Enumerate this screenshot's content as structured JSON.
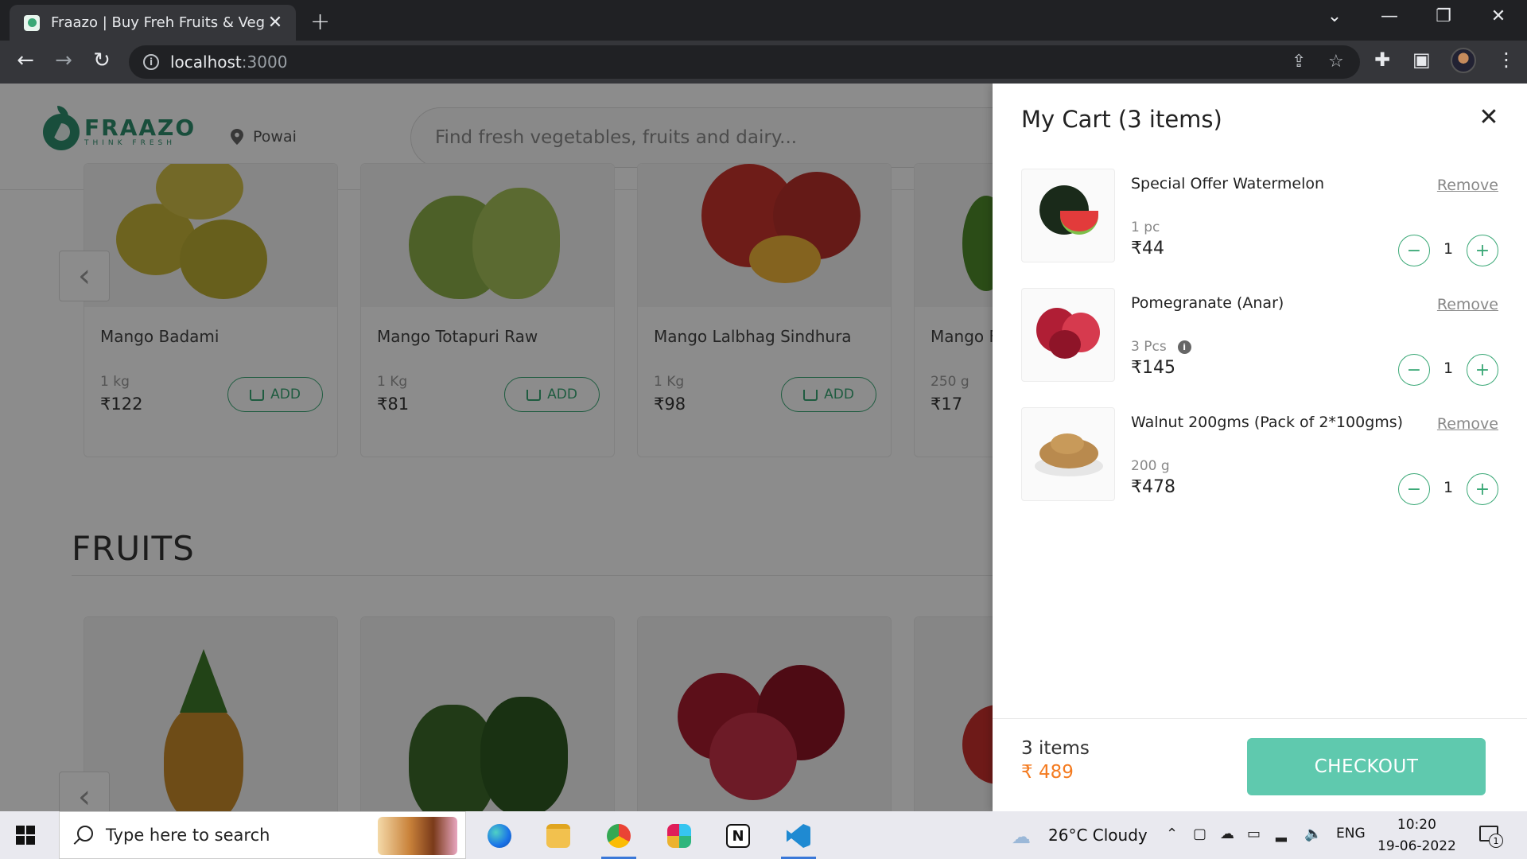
{
  "browser": {
    "tab_title": "Fraazo | Buy Freh Fruits & Vegitab",
    "url_host": "localhost",
    "url_port": ":3000"
  },
  "site": {
    "logo_name": "FRAAZO",
    "logo_tagline": "THINK FRESH",
    "location": "Powai",
    "search_placeholder": "Find fresh vegetables, fruits and dairy...",
    "add_label": "ADD",
    "products": [
      {
        "name": "Mango Badami",
        "qty": "1 kg",
        "price": "₹122"
      },
      {
        "name": "Mango Totapuri Raw",
        "qty": "1 Kg",
        "price": "₹81"
      },
      {
        "name": "Mango Lalbhag Sindhura",
        "qty": "1 Kg",
        "price": "₹98"
      },
      {
        "name": "Mango F",
        "qty": "250 g",
        "price": "₹17"
      }
    ],
    "section_title": "FRUITS"
  },
  "cart": {
    "title": "My Cart (3 items)",
    "remove_label": "Remove",
    "items": [
      {
        "name": "Special Offer Watermelon",
        "qty": "1 pc",
        "price": "₹44",
        "count": "1",
        "info": false
      },
      {
        "name": "Pomegranate (Anar)",
        "qty": "3 Pcs",
        "price": "₹145",
        "count": "1",
        "info": true
      },
      {
        "name": "Walnut 200gms (Pack of 2*100gms)",
        "qty": "200 g",
        "price": "₹478",
        "count": "1",
        "info": false
      }
    ],
    "footer_count": "3 items",
    "footer_total": "₹ 489",
    "checkout_label": "CHECKOUT"
  },
  "taskbar": {
    "search_placeholder": "Type here to search",
    "weather": "26°C  Cloudy",
    "language": "ENG",
    "time": "10:20",
    "date": "19-06-2022",
    "notification_count": "1"
  },
  "colors": {
    "brand_green": "#2f8f6e",
    "accent_teal": "#5fc9ae",
    "price_orange": "#f47b20"
  }
}
